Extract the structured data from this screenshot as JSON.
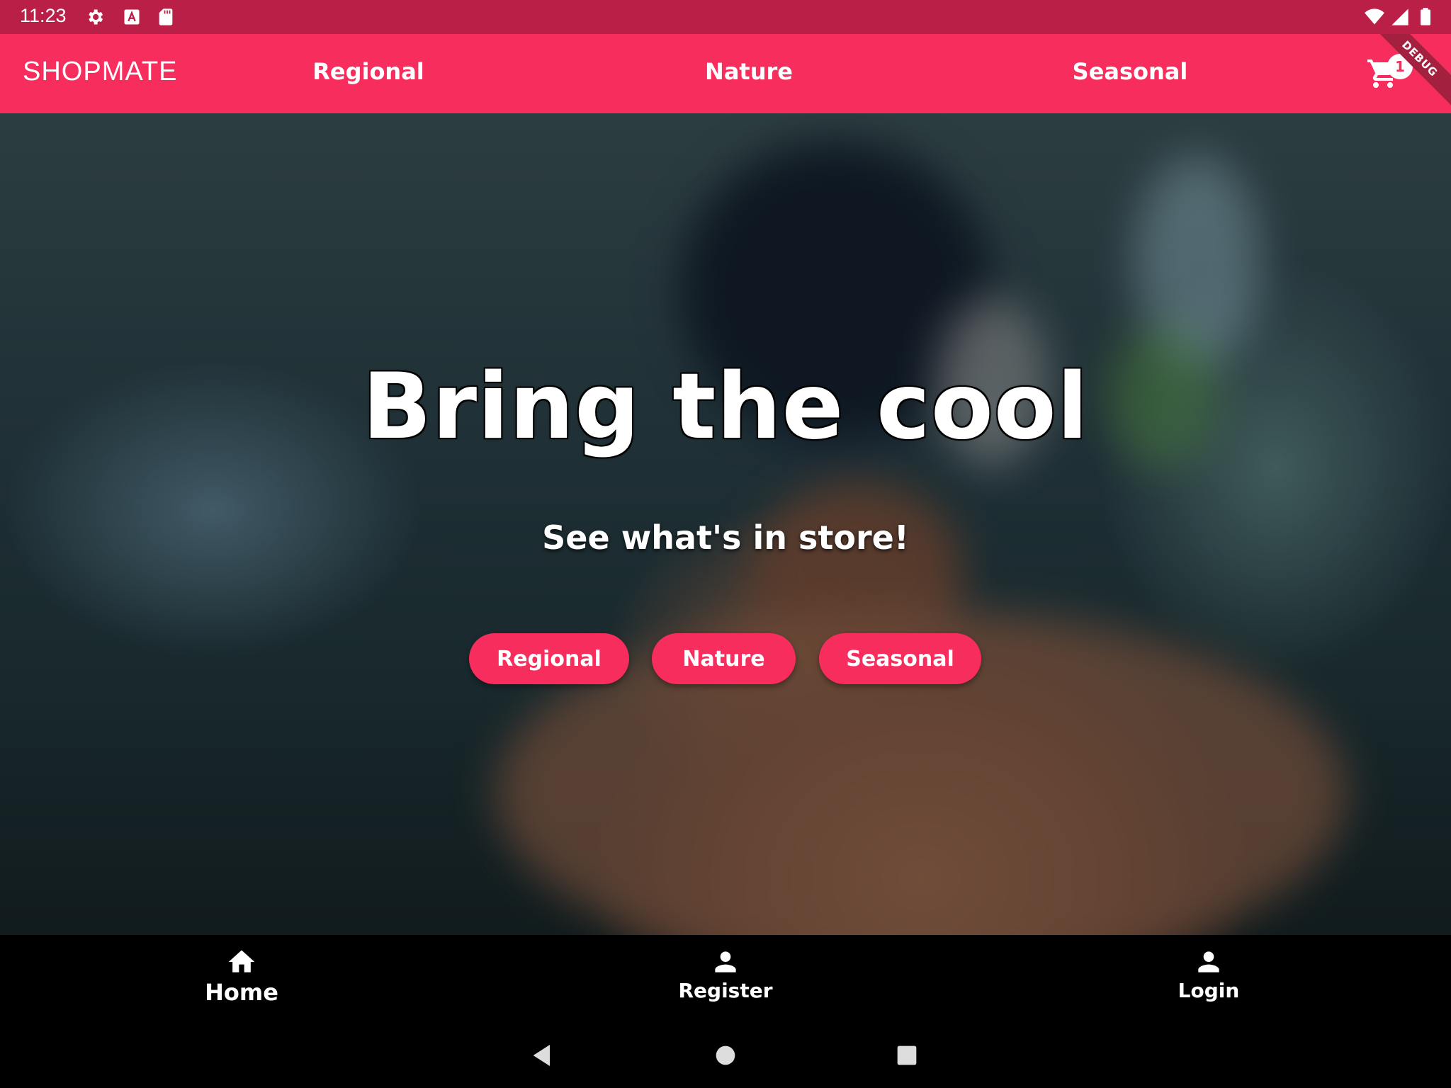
{
  "status_bar": {
    "time": "11:23",
    "icons": [
      "settings-icon",
      "a-keyboard-icon",
      "sd-card-icon",
      "wifi-icon",
      "cell-signal-icon",
      "battery-icon"
    ]
  },
  "app_bar": {
    "brand": "SHOPMATE",
    "tabs": [
      {
        "label": "Regional"
      },
      {
        "label": "Nature"
      },
      {
        "label": "Seasonal"
      }
    ],
    "cart_count": "1",
    "debug_banner": "DEBUG",
    "color": "#f72d5e"
  },
  "hero": {
    "title": "Bring the cool",
    "subtitle": "See what's in store!",
    "buttons": [
      {
        "label": "Regional"
      },
      {
        "label": "Nature"
      },
      {
        "label": "Seasonal"
      }
    ]
  },
  "bottom_nav": {
    "items": [
      {
        "label": "Home",
        "icon": "home-icon",
        "active": true
      },
      {
        "label": "Register",
        "icon": "person-icon",
        "active": false
      },
      {
        "label": "Login",
        "icon": "person-icon",
        "active": false
      }
    ]
  },
  "system_nav": {
    "icons": [
      "back-icon",
      "home-circle-icon",
      "recents-icon"
    ]
  }
}
